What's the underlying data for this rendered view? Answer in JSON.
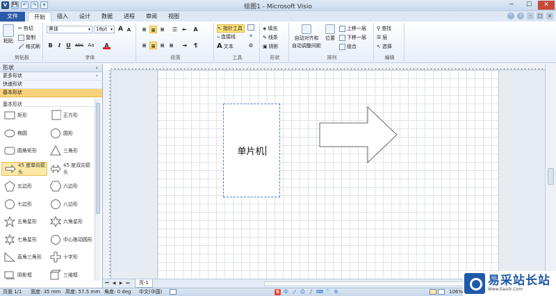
{
  "titlebar": {
    "title": "绘图1 - Microsoft Visio",
    "qat": [
      "V",
      "💾",
      "↶",
      "↷",
      "▾"
    ],
    "minimize": "─",
    "maximize": "☐",
    "close": "✕"
  },
  "tabs": [
    {
      "label": "文件"
    },
    {
      "label": "开始"
    },
    {
      "label": "插入"
    },
    {
      "label": "设计"
    },
    {
      "label": "数据"
    },
    {
      "label": "进程"
    },
    {
      "label": "审阅"
    },
    {
      "label": "视图"
    }
  ],
  "ribbon": {
    "clipboard": {
      "paste": "粘贴",
      "cut": "剪切",
      "copy": "复制",
      "format_painter": "格式刷",
      "label": "剪贴板"
    },
    "font": {
      "name": "黑体",
      "size": "18pt",
      "grow": "A",
      "shrink": "A",
      "bold": "B",
      "italic": "I",
      "underline": "U",
      "strike": "abc",
      "case": "Aa",
      "color": "A",
      "label": "字体"
    },
    "paragraph": {
      "label": "段落"
    },
    "tools": {
      "pointer": "指针工具",
      "connector": "连接线",
      "text": "文本",
      "label": "工具"
    },
    "shape": {
      "fill": "填充",
      "line": "线条",
      "shadow": "阴影",
      "label": "形状"
    },
    "arrange": {
      "auto_align": "自动对齐和",
      "auto_space": "自动调整间距",
      "position": "位置",
      "bring_forward": "上移一层",
      "send_backward": "下移一层",
      "group": "组合",
      "label": "排列"
    },
    "editing": {
      "find": "查找",
      "layers": "层",
      "select": "选择",
      "label": "编辑"
    }
  },
  "pane": {
    "title": "形状",
    "rows": [
      {
        "label": "更多形状"
      },
      {
        "label": "快速形状"
      },
      {
        "label": "基本形状"
      }
    ],
    "stencil_title": "基本形状",
    "shapes": [
      {
        "label": "矩形"
      },
      {
        "label": "正方形"
      },
      {
        "label": "椭圆"
      },
      {
        "label": "圆形"
      },
      {
        "label": "圆角矩形"
      },
      {
        "label": "三角形"
      },
      {
        "label": "45 度单向箭头"
      },
      {
        "label": "45 度双向箭头"
      },
      {
        "label": "五边形"
      },
      {
        "label": "六边形"
      },
      {
        "label": "七边形"
      },
      {
        "label": "八边形"
      },
      {
        "label": "五角星形"
      },
      {
        "label": "六角星形"
      },
      {
        "label": "七角星形"
      },
      {
        "label": "中心拖动圆形"
      },
      {
        "label": "直角三角形"
      },
      {
        "label": "十字形"
      },
      {
        "label": "阴影框"
      },
      {
        "label": "三维框"
      }
    ]
  },
  "canvas": {
    "rect_text": "单片机"
  },
  "pagetabs": {
    "nav": [
      "⏮",
      "◀",
      "▶",
      "⏭"
    ],
    "page": "页-1"
  },
  "status": {
    "page": "页面 1/1",
    "width": "宽度: 35 mm",
    "height": "高度: 57.5 mm",
    "angle": "角度: 0 deg",
    "lang": "中文(中国)",
    "zoom": "106%"
  },
  "logo": {
    "name": "易采站长站",
    "url_text": "Www.Easck.Com"
  }
}
